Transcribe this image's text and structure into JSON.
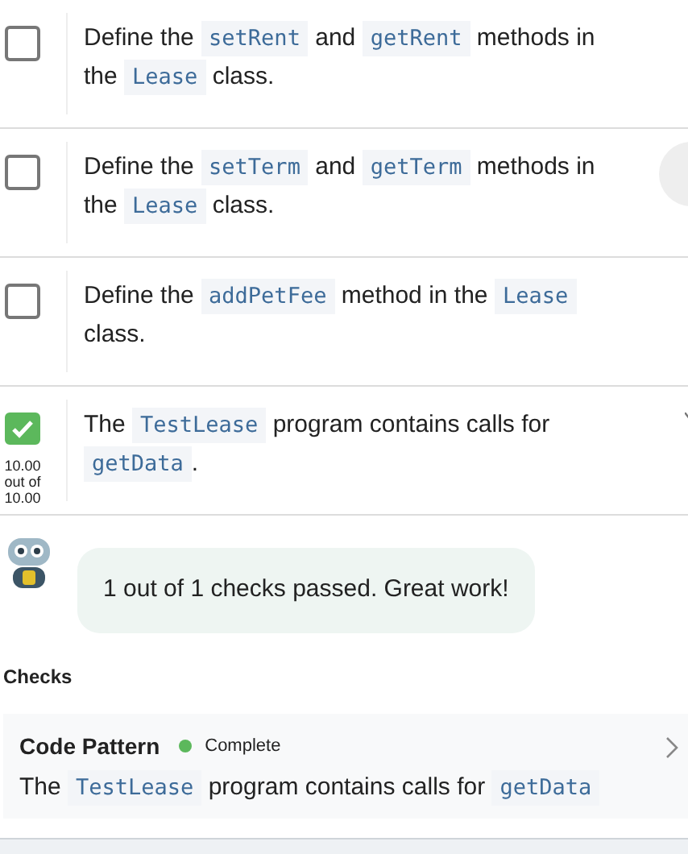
{
  "tasks": [
    {
      "checked": false,
      "segments": [
        {
          "text": "Define the "
        },
        {
          "code": "setRent"
        },
        {
          "text": " and "
        },
        {
          "code": "getRent"
        },
        {
          "text": " methods in the "
        },
        {
          "code": "Lease"
        },
        {
          "text": " class."
        }
      ]
    },
    {
      "checked": false,
      "segments": [
        {
          "text": "Define the "
        },
        {
          "code": "setTerm"
        },
        {
          "text": " and "
        },
        {
          "code": "getTerm"
        },
        {
          "text": " methods in the "
        },
        {
          "code": "Lease"
        },
        {
          "text": " class."
        }
      ]
    },
    {
      "checked": false,
      "segments": [
        {
          "text": "Define the "
        },
        {
          "code": "addPetFee"
        },
        {
          "text": " method in the "
        },
        {
          "code": "Lease"
        },
        {
          "text": " class."
        }
      ]
    },
    {
      "checked": true,
      "score": "10.00 out of 10.00",
      "segments": [
        {
          "text": "The "
        },
        {
          "code": "TestLease"
        },
        {
          "text": " program contains calls for "
        },
        {
          "code": "getData"
        },
        {
          "text": "."
        }
      ]
    }
  ],
  "feedback": "1 out of 1 checks passed. Great work!",
  "checks_heading": "Checks",
  "checks": [
    {
      "title": "Code Pattern",
      "status": "Complete",
      "color": "#5cb85c",
      "segments": [
        {
          "text": "The "
        },
        {
          "code": "TestLease"
        },
        {
          "text": " program contains calls for "
        },
        {
          "code": "getData"
        }
      ]
    }
  ]
}
